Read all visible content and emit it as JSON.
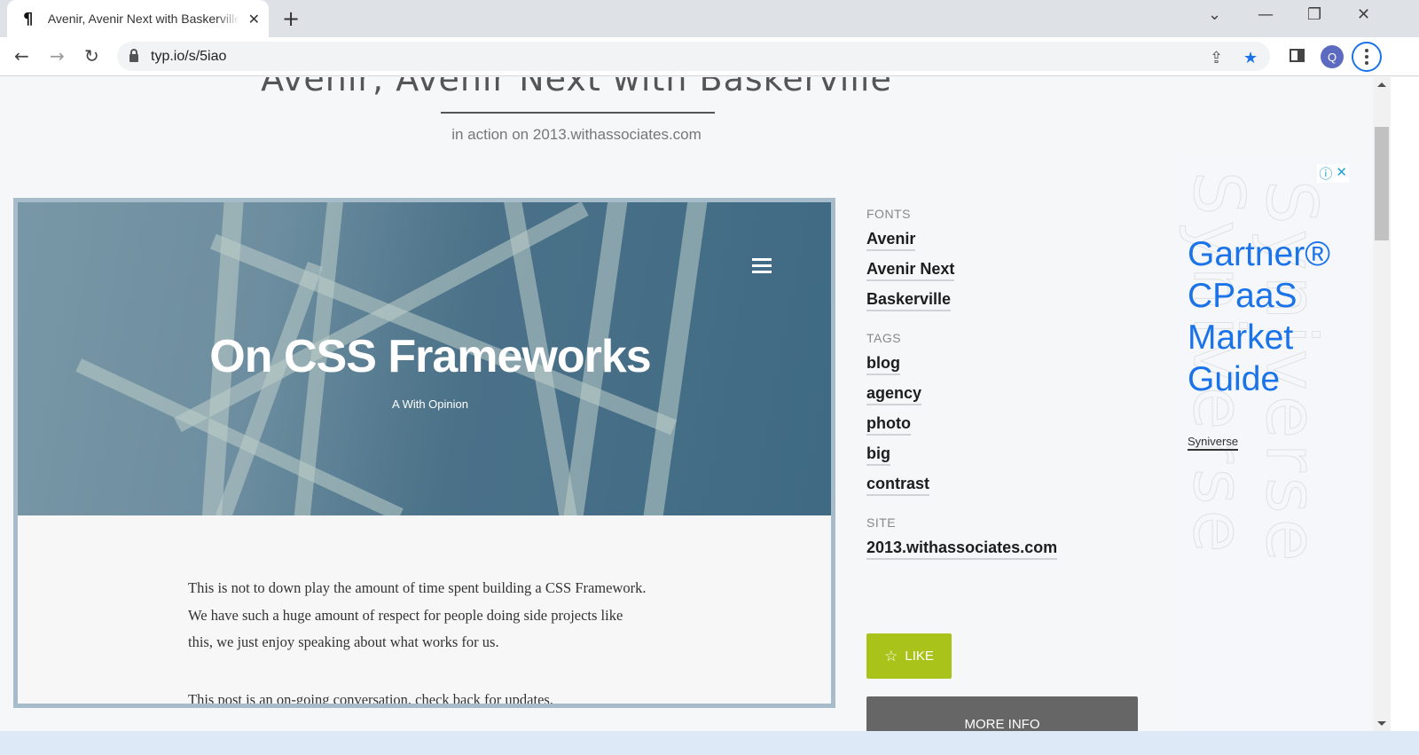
{
  "browser": {
    "tab": {
      "favicon": "typ.io-pilcrow-icon",
      "title": "Avenir, Avenir Next with Baskerville",
      "close_glyph": "✕"
    },
    "new_tab_glyph": "+",
    "window_controls": {
      "tab_search": "⌄",
      "minimize": "—",
      "restore": "❐",
      "close": "✕"
    },
    "nav": {
      "back": "←",
      "forward": "→",
      "reload": "↻"
    },
    "url": "typ.io/s/5iao",
    "share_glyph": "⇪",
    "bookmark_glyph": "★",
    "profile_initial": "Q",
    "bookmark_color": "#1a73e8"
  },
  "page": {
    "title": "Avenir, Avenir Next with Baskerville",
    "subtitle": "in action on 2013.withassociates.com",
    "preview": {
      "hero_title": "On CSS Frameworks",
      "hero_subtitle": "A With Opinion",
      "paragraphs": [
        "This is not to down play the amount of time spent building a CSS Framework. We have such a huge amount of respect for people doing side projects like this, we just enjoy speaking about what works for us.",
        "This post is an on-going conversation, check back for updates."
      ]
    },
    "sidebar": {
      "fonts_label": "FONTS",
      "fonts": [
        "Avenir",
        "Avenir Next",
        "Baskerville"
      ],
      "tags_label": "TAGS",
      "tags": [
        "blog",
        "agency",
        "photo",
        "big",
        "contrast"
      ],
      "site_label": "SITE",
      "site": "2013.withassociates.com",
      "like_label": "LIKE",
      "like_glyph": "☆",
      "more_info_label": "MORE INFO",
      "like_color": "#a9c31a"
    },
    "ad": {
      "info_glyph": "ⓘ",
      "close_glyph": "✕",
      "headline_lines": [
        "Gartner®",
        "CPaaS",
        "Market",
        "Guide"
      ],
      "brand": "Syniverse",
      "watermark": "Syniverse",
      "headline_color": "#1a73e8"
    }
  }
}
